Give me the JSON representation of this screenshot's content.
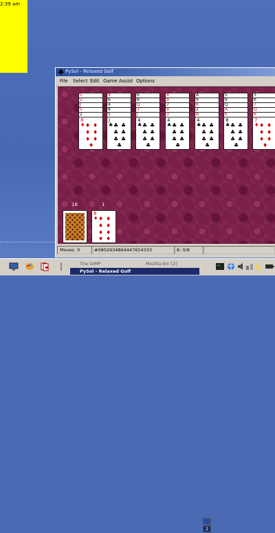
{
  "clock": {
    "time": "2:39 am"
  },
  "window": {
    "title": "PySol - Relaxed Golf",
    "menu": [
      "File",
      "Select",
      "Edit",
      "Game",
      "Assist",
      "Options"
    ]
  },
  "tableau": [
    {
      "stack": [
        "5",
        "2",
        "J",
        "5",
        "2"
      ],
      "stack_colors": [
        "red",
        "red",
        "blk",
        "red",
        "blk"
      ],
      "top": {
        "rank": "8",
        "suit": "♦",
        "color": "red"
      }
    },
    {
      "stack": [
        "9",
        "6",
        "4",
        "8",
        "5"
      ],
      "stack_colors": [
        "red",
        "blk",
        "blk",
        "blk",
        "blk"
      ],
      "top": {
        "rank": "J",
        "suit": "♣",
        "color": "blk"
      }
    },
    {
      "stack": [
        "6",
        "8",
        "Q",
        "3",
        "J"
      ],
      "stack_colors": [
        "blk",
        "blk",
        "red",
        "red",
        "red"
      ],
      "top": {
        "rank": "4",
        "suit": "♣",
        "color": "blk"
      }
    },
    {
      "stack": [
        "4",
        "9",
        "7",
        "9",
        "3"
      ],
      "stack_colors": [
        "red",
        "red",
        "blk",
        "red",
        "red"
      ],
      "top": {
        "rank": "4",
        "suit": "♣",
        "color": "blk"
      }
    },
    {
      "stack": [
        "A",
        "9",
        "K",
        "2",
        "A"
      ],
      "stack_colors": [
        "blk",
        "blk",
        "red",
        "blk",
        "red"
      ],
      "top": {
        "rank": "4",
        "suit": "♣",
        "color": "blk"
      }
    },
    {
      "stack": [
        "5",
        "9",
        "Q",
        "A",
        "K"
      ],
      "stack_colors": [
        "blk",
        "blk",
        "blk",
        "red",
        "red"
      ],
      "top": {
        "rank": "8",
        "suit": "♣",
        "color": "blk"
      }
    },
    {
      "stack": [
        "3",
        "K",
        "7",
        "Q",
        "6"
      ],
      "stack_colors": [
        "blk",
        "blk",
        "red",
        "red",
        "red"
      ],
      "top": {
        "rank": "7",
        "suit": "♦",
        "color": "red"
      }
    }
  ],
  "stock": {
    "count": "16"
  },
  "waste": {
    "count": "1",
    "rank": "8",
    "suit": "♦",
    "color": "red"
  },
  "status": {
    "moves": "Moves: 0",
    "game_id": "#0802934864447654333",
    "score": "8: 0/8"
  },
  "taskbar": {
    "tasks": [
      "The GIMP",
      "Mozilla-bin [2]",
      "PySol - Relaxed Golf"
    ],
    "pager": "2"
  }
}
